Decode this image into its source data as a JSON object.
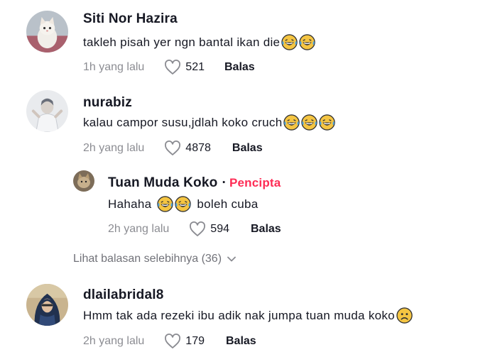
{
  "comments": [
    {
      "username": "Siti Nor Hazira",
      "text": "takleh pisah yer ngn bantal ikan die",
      "emojis": [
        "laugh-emoji",
        "laugh-emoji"
      ],
      "time": "1h yang lalu",
      "likes": "521",
      "reply_label": "Balas",
      "avatar_icon": "cat-avatar"
    },
    {
      "username": "nurabiz",
      "text": "kalau campor susu,jdlah koko cruch",
      "emojis": [
        "laugh-emoji",
        "laugh-emoji",
        "laugh-emoji"
      ],
      "time": "2h yang lalu",
      "likes": "4878",
      "reply_label": "Balas",
      "avatar_icon": "person-avatar"
    },
    {
      "username": "Tuan Muda Koko",
      "badge_separator": "·",
      "badge": "Pencipta",
      "text_before": "Hahaha",
      "text_after": "boleh cuba",
      "emojis": [
        "laugh-emoji",
        "laugh-emoji"
      ],
      "time": "2h yang lalu",
      "likes": "594",
      "reply_label": "Balas",
      "avatar_icon": "cat-avatar"
    },
    {
      "username": "dlailabridal8",
      "text": "Hmm tak ada rezeki ibu adik nak jumpa tuan muda koko",
      "emojis": [
        "sad-emoji"
      ],
      "time": "2h yang lalu",
      "likes": "179",
      "reply_label": "Balas",
      "avatar_icon": "hijab-person-avatar"
    }
  ],
  "view_more_replies": "Lihat balasan selebihnya (36)",
  "colors": {
    "text": "#161823",
    "muted": "rgba(22,24,35,0.5)",
    "creator_badge": "#fe2c55"
  }
}
